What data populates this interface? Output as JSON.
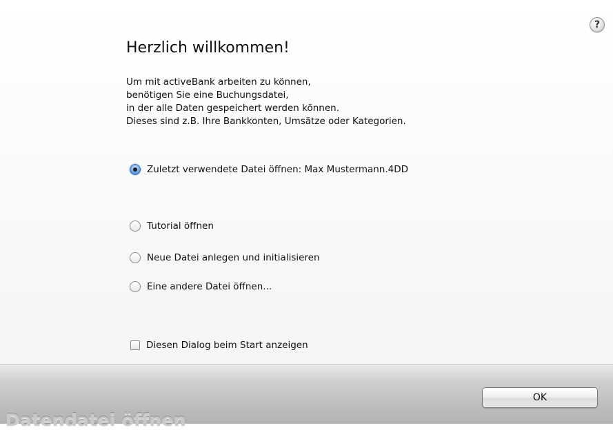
{
  "dialog": {
    "help_label": "?",
    "title": "Herzlich willkommen!",
    "intro_lines": [
      "Um mit activeBank arbeiten zu können,",
      "benötigen Sie eine Buchungsdatei,",
      "in der alle Daten gespeichert werden können.",
      "Dieses sind z.B. Ihre Bankkonten, Umsätze oder Kategorien."
    ],
    "options": [
      {
        "label": "Zuletzt verwendete Datei öffnen: Max Mustermann.4DD",
        "selected": true
      },
      {
        "label": "Tutorial öffnen",
        "selected": false
      },
      {
        "label": "Neue Datei anlegen und initialisieren",
        "selected": false
      },
      {
        "label": "Eine andere Datei öffnen...",
        "selected": false
      }
    ],
    "show_on_start": {
      "label": "Diesen Dialog beim Start anzeigen",
      "checked": false
    }
  },
  "footer": {
    "title": "Datendatei öffnen",
    "ok_label": "OK"
  },
  "colors": {
    "radio_selected": "#2f6dbf",
    "footer_gradient_top": "#e8e8e8",
    "footer_gradient_bottom": "#b3b3b3"
  },
  "icons": {
    "help": "question-mark-circle"
  }
}
